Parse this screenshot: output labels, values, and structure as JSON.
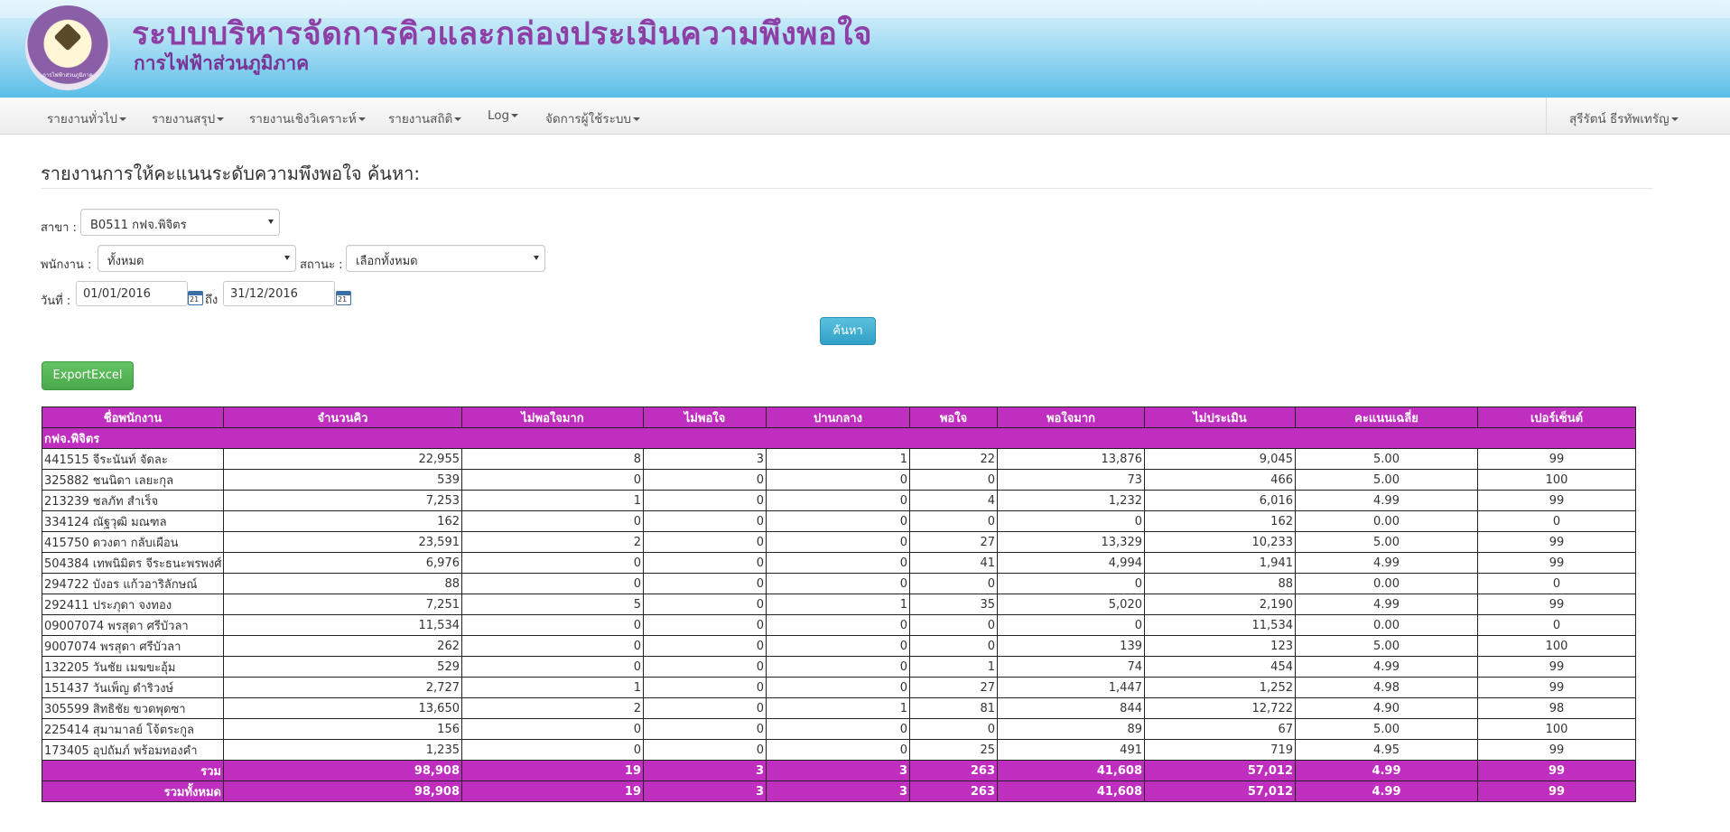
{
  "header": {
    "title": "ระบบบริหารจัดการคิวและกล่องประเมินความพึงพอใจ",
    "subtitle": "การไฟฟ้าส่วนภูมิภาค",
    "logo_text": "การไฟฟ้าส่วนภูมิภาค"
  },
  "nav": {
    "items": [
      "รายงานทั่วไป",
      "รายงานสรุป",
      "รายงานเชิงวิเคราะห์",
      "รายงานสถิติ",
      "Log",
      "จัดการผู้ใช้ระบบ"
    ],
    "user": "สุรีรัตน์ ธีรทัพเทรัญ"
  },
  "page": {
    "title": "รายงานการให้คะแนนระดับความพึงพอใจ ค้นหา:"
  },
  "form": {
    "branch_label": "สาขา :",
    "branch_value": "B0511 กฟจ.พิจิตร",
    "employee_label": "พนักงาน :",
    "employee_value": "ทั้งหมด",
    "status_label": "สถานะ :",
    "status_value": "เลือกทั้งหมด",
    "date_label": "วันที่ :",
    "date_from": "01/01/2016",
    "to_label": "ถึง",
    "date_to": "31/12/2016",
    "calendar_icon_text": "21",
    "search_button": "ค้นหา",
    "export_button": "ExportExcel"
  },
  "table": {
    "headers": [
      "ชื่อพนักงาน",
      "จำนวนคิว",
      "ไม่พอใจมาก",
      "ไม่พอใจ",
      "ปานกลาง",
      "พอใจ",
      "พอใจมาก",
      "ไม่ประเมิน",
      "คะแนนเฉลี่ย",
      "เปอร์เซ็นต์"
    ],
    "group": "กฟจ.พิจิตร",
    "rows": [
      [
        "441515 จีระนันท์ จัดละ",
        "22,955",
        "8",
        "3",
        "1",
        "22",
        "13,876",
        "9,045",
        "5.00",
        "99"
      ],
      [
        "325882 ชนนิดา เลยะกุล",
        "539",
        "0",
        "0",
        "0",
        "0",
        "73",
        "466",
        "5.00",
        "100"
      ],
      [
        "213239 ชลภัท สำเร็จ",
        "7,253",
        "1",
        "0",
        "0",
        "4",
        "1,232",
        "6,016",
        "4.99",
        "99"
      ],
      [
        "334124 ณัฐวุฒิ มณฑล",
        "162",
        "0",
        "0",
        "0",
        "0",
        "0",
        "162",
        "0.00",
        "0"
      ],
      [
        "415750 ดวงตา กลับเผือน",
        "23,591",
        "2",
        "0",
        "0",
        "27",
        "13,329",
        "10,233",
        "5.00",
        "99"
      ],
      [
        "504384 เทพนิมิตร จีระธนะพรพงศ์",
        "6,976",
        "0",
        "0",
        "0",
        "41",
        "4,994",
        "1,941",
        "4.99",
        "99"
      ],
      [
        "294722 บังอร แก้วอาริลักษณ์",
        "88",
        "0",
        "0",
        "0",
        "0",
        "0",
        "88",
        "0.00",
        "0"
      ],
      [
        "292411 ประภุดา จงทอง",
        "7,251",
        "5",
        "0",
        "1",
        "35",
        "5,020",
        "2,190",
        "4.99",
        "99"
      ],
      [
        "09007074 พรสุดา ศรีบัวลา",
        "11,534",
        "0",
        "0",
        "0",
        "0",
        "0",
        "11,534",
        "0.00",
        "0"
      ],
      [
        "9007074 พรสุดา ศรีบัวลา",
        "262",
        "0",
        "0",
        "0",
        "0",
        "139",
        "123",
        "5.00",
        "100"
      ],
      [
        "132205 วันชัย เมฆขะอุ้ม",
        "529",
        "0",
        "0",
        "0",
        "1",
        "74",
        "454",
        "4.99",
        "99"
      ],
      [
        "151437 วันเพ็ญ ดำริวงษ์",
        "2,727",
        "1",
        "0",
        "0",
        "27",
        "1,447",
        "1,252",
        "4.98",
        "99"
      ],
      [
        "305599 สิทธิชัย ขวดพุดซา",
        "13,650",
        "2",
        "0",
        "1",
        "81",
        "844",
        "12,722",
        "4.90",
        "98"
      ],
      [
        "225414 สุมามาลย์ โจ้ตระกูล",
        "156",
        "0",
        "0",
        "0",
        "0",
        "89",
        "67",
        "5.00",
        "100"
      ],
      [
        "173405 อุปถัมภ์ พร้อมทองคำ",
        "1,235",
        "0",
        "0",
        "0",
        "25",
        "491",
        "719",
        "4.95",
        "99"
      ]
    ],
    "subtotal": [
      "รวม",
      "98,908",
      "19",
      "3",
      "3",
      "263",
      "41,608",
      "57,012",
      "4.99",
      "99"
    ],
    "total": [
      "รวมทั้งหมด",
      "98,908",
      "19",
      "3",
      "3",
      "263",
      "41,608",
      "57,012",
      "4.99",
      "99"
    ]
  }
}
